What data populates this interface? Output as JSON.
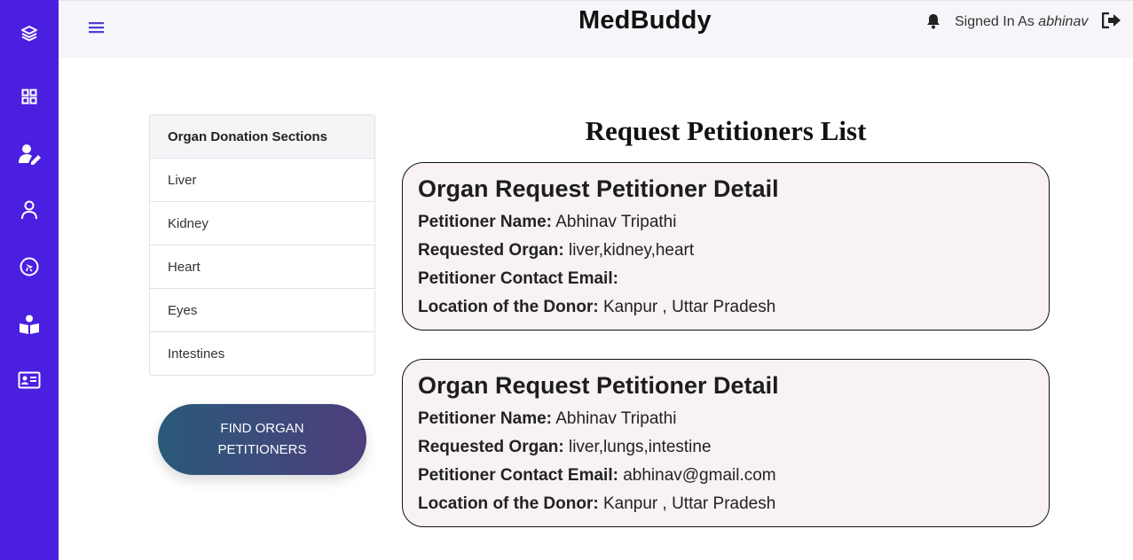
{
  "app": {
    "brand": "MedBuddy",
    "signed_in_prefix": "Signed In As",
    "username": "abhinav"
  },
  "sidebar": {
    "icons": [
      "layers-icon",
      "dashboard-icon",
      "user-edit-icon",
      "user-icon",
      "compass-icon",
      "book-reader-icon",
      "id-card-icon"
    ]
  },
  "sections": {
    "header": "Organ Donation Sections",
    "items": [
      "Liver",
      "Kidney",
      "Heart",
      "Eyes",
      "Intestines"
    ]
  },
  "find_button": "FIND ORGAN PETITIONERS",
  "list": {
    "title": "Request Petitioners List",
    "cards": [
      {
        "heading": "Organ Request Petitioner Detail",
        "name_label": "Petitioner Name:",
        "name": "Abhinav Tripathi",
        "organ_label": "Requested Organ:",
        "organ": "liver,kidney,heart",
        "email_label": "Petitioner Contact Email:",
        "email": "",
        "location_label": "Location of the Donor:",
        "location": "Kanpur , Uttar Pradesh"
      },
      {
        "heading": "Organ Request Petitioner Detail",
        "name_label": "Petitioner Name:",
        "name": "Abhinav Tripathi",
        "organ_label": "Requested Organ:",
        "organ": "liver,lungs,intestine",
        "email_label": "Petitioner Contact Email:",
        "email": "abhinav@gmail.com",
        "location_label": "Location of the Donor:",
        "location": "Kanpur , Uttar Pradesh"
      }
    ]
  },
  "colors": {
    "sidebar": "#4a1fe0",
    "accent": "#4a3ed8",
    "card_bg": "#f8f2f2"
  }
}
